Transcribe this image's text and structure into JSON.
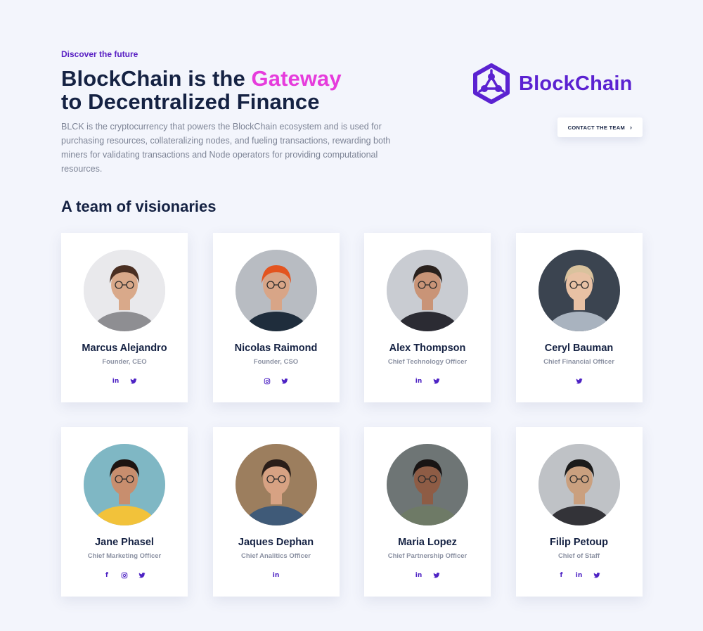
{
  "hero": {
    "eyebrow": "Discover the future",
    "headline_line1_prefix": "BlockChain is the ",
    "headline_accent": "Gateway",
    "headline_line2": "to Decentralized Finance",
    "description": "BLCK is the cryptocurrency that powers the BlockChain ecosystem and is used for purchasing resources, collateralizing nodes, and fueling transactions, rewarding both miners for validating transactions and Node operators for providing computational resources."
  },
  "brand": {
    "name": "BlockChain",
    "logo_icon": "hexagon-network-icon"
  },
  "contact_button": {
    "label": "CONTACT THE TEAM",
    "chevron": "›"
  },
  "team": {
    "title": "A team of visionaries",
    "members": [
      {
        "name": "Marcus Alejandro",
        "role": "Founder, CEO",
        "socials": [
          "linkedin",
          "twitter"
        ]
      },
      {
        "name": "Nicolas Raimond",
        "role": "Founder, CSO",
        "socials": [
          "instagram",
          "twitter"
        ]
      },
      {
        "name": "Alex Thompson",
        "role": "Chief Technology Officer",
        "socials": [
          "linkedin",
          "twitter"
        ]
      },
      {
        "name": "Ceryl Bauman",
        "role": "Chief Financial Officer",
        "socials": [
          "twitter"
        ]
      },
      {
        "name": "Jane Phasel",
        "role": "Chief Marketing Officer",
        "socials": [
          "facebook",
          "instagram",
          "twitter"
        ]
      },
      {
        "name": "Jaques Dephan",
        "role": "Chief Analitics Officer",
        "socials": [
          "linkedin"
        ]
      },
      {
        "name": "Maria Lopez",
        "role": "Chief Partnership Officer",
        "socials": [
          "linkedin",
          "twitter"
        ]
      },
      {
        "name": "Filip Petoup",
        "role": "Chief of Staff",
        "socials": [
          "facebook",
          "linkedin",
          "twitter"
        ]
      }
    ]
  },
  "colors": {
    "brand": "#5b22d1",
    "accent": "#e63cdc",
    "heading": "#152243",
    "body_text": "#7d8496",
    "background": "#f3f5fc"
  },
  "social_glyphs": {
    "linkedin": "in",
    "facebook": "f"
  }
}
